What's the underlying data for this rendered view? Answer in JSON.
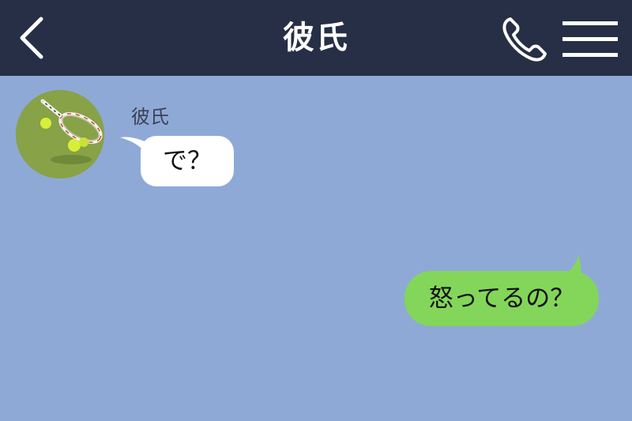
{
  "header": {
    "title": "彼氏",
    "back_icon": "chevron-left-icon",
    "call_icon": "phone-icon",
    "menu_icon": "hamburger-menu-icon"
  },
  "messages": [
    {
      "direction": "incoming",
      "sender": "彼氏",
      "text": "で？",
      "avatar": "tennis-racket-balls-avatar"
    },
    {
      "direction": "outgoing",
      "text": "怒ってるの？"
    }
  ],
  "colors": {
    "header_bg": "#262f45",
    "chat_bg": "#8fa9d6",
    "incoming_bubble": "#ffffff",
    "outgoing_bubble": "#83d65a"
  }
}
